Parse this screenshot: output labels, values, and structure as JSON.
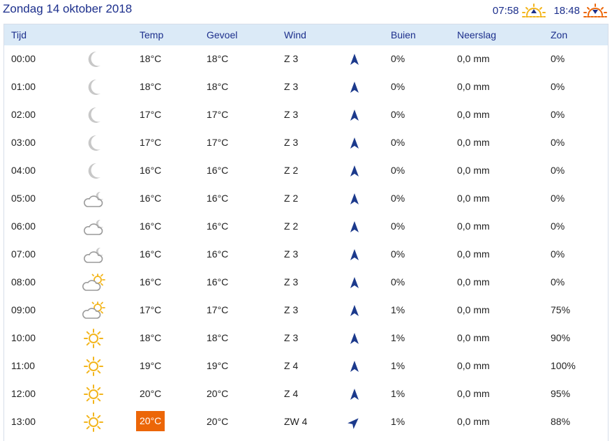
{
  "header": {
    "title": "Zondag 14 oktober 2018",
    "sunrise": "07:58",
    "sunset": "18:48",
    "sunrise_icon": "sunrise-icon",
    "sunset_icon": "sunset-icon"
  },
  "columns": {
    "time": "Tijd",
    "temp": "Temp",
    "feel": "Gevoel",
    "wind": "Wind",
    "showers": "Buien",
    "precip": "Neerslag",
    "sun": "Zon"
  },
  "colors": {
    "accent": "#1c2f8c",
    "header_bg": "#dbeaf7",
    "highlight": "#ec6608",
    "sun": "#f3b51c",
    "moon": "#c8c8c8"
  },
  "rows": [
    {
      "time": "00:00",
      "icon": "moon-icon",
      "temp": "18°C",
      "feel": "18°C",
      "wind": "Z 3",
      "wind_dir_deg": 0,
      "showers": "0%",
      "precip": "0,0 mm",
      "sun": "0%"
    },
    {
      "time": "01:00",
      "icon": "moon-icon",
      "temp": "18°C",
      "feel": "18°C",
      "wind": "Z 3",
      "wind_dir_deg": 0,
      "showers": "0%",
      "precip": "0,0 mm",
      "sun": "0%"
    },
    {
      "time": "02:00",
      "icon": "moon-icon",
      "temp": "17°C",
      "feel": "17°C",
      "wind": "Z 3",
      "wind_dir_deg": 0,
      "showers": "0%",
      "precip": "0,0 mm",
      "sun": "0%"
    },
    {
      "time": "03:00",
      "icon": "moon-icon",
      "temp": "17°C",
      "feel": "17°C",
      "wind": "Z 3",
      "wind_dir_deg": 0,
      "showers": "0%",
      "precip": "0,0 mm",
      "sun": "0%"
    },
    {
      "time": "04:00",
      "icon": "moon-icon",
      "temp": "16°C",
      "feel": "16°C",
      "wind": "Z 2",
      "wind_dir_deg": 0,
      "showers": "0%",
      "precip": "0,0 mm",
      "sun": "0%"
    },
    {
      "time": "05:00",
      "icon": "cloud-moon-icon",
      "temp": "16°C",
      "feel": "16°C",
      "wind": "Z 2",
      "wind_dir_deg": 0,
      "showers": "0%",
      "precip": "0,0 mm",
      "sun": "0%"
    },
    {
      "time": "06:00",
      "icon": "cloud-moon-icon",
      "temp": "16°C",
      "feel": "16°C",
      "wind": "Z 2",
      "wind_dir_deg": 0,
      "showers": "0%",
      "precip": "0,0 mm",
      "sun": "0%"
    },
    {
      "time": "07:00",
      "icon": "cloud-moon-icon",
      "temp": "16°C",
      "feel": "16°C",
      "wind": "Z 3",
      "wind_dir_deg": 0,
      "showers": "0%",
      "precip": "0,0 mm",
      "sun": "0%"
    },
    {
      "time": "08:00",
      "icon": "cloud-sun-icon",
      "temp": "16°C",
      "feel": "16°C",
      "wind": "Z 3",
      "wind_dir_deg": 0,
      "showers": "0%",
      "precip": "0,0 mm",
      "sun": "0%"
    },
    {
      "time": "09:00",
      "icon": "cloud-sun-icon",
      "temp": "17°C",
      "feel": "17°C",
      "wind": "Z 3",
      "wind_dir_deg": 0,
      "showers": "1%",
      "precip": "0,0 mm",
      "sun": "75%"
    },
    {
      "time": "10:00",
      "icon": "sun-icon",
      "temp": "18°C",
      "feel": "18°C",
      "wind": "Z 3",
      "wind_dir_deg": 0,
      "showers": "1%",
      "precip": "0,0 mm",
      "sun": "90%"
    },
    {
      "time": "11:00",
      "icon": "sun-icon",
      "temp": "19°C",
      "feel": "19°C",
      "wind": "Z 4",
      "wind_dir_deg": 0,
      "showers": "1%",
      "precip": "0,0 mm",
      "sun": "100%"
    },
    {
      "time": "12:00",
      "icon": "sun-icon",
      "temp": "20°C",
      "feel": "20°C",
      "wind": "Z 4",
      "wind_dir_deg": 0,
      "showers": "1%",
      "precip": "0,0 mm",
      "sun": "95%"
    },
    {
      "time": "13:00",
      "icon": "sun-icon",
      "temp": "20°C",
      "temp_highlight": true,
      "feel": "20°C",
      "wind": "ZW 4",
      "wind_dir_deg": 45,
      "showers": "1%",
      "precip": "0,0 mm",
      "sun": "88%"
    }
  ]
}
